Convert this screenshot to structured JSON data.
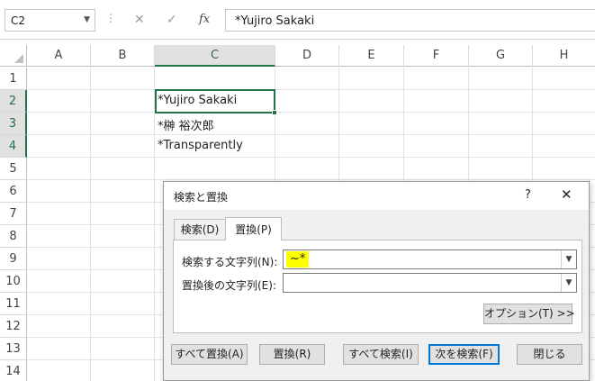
{
  "formula_bar": {
    "name_box": "C2",
    "cancel_symbol": "✕",
    "enter_symbol": "✓",
    "fx_label": "fx",
    "formula_value": "*Yujiro Sakaki"
  },
  "sheet": {
    "columns": [
      "A",
      "B",
      "C",
      "D",
      "E",
      "F",
      "G",
      "H"
    ],
    "rows": [
      "1",
      "2",
      "3",
      "4",
      "5",
      "6",
      "7",
      "8",
      "9",
      "10",
      "11",
      "12",
      "13",
      "14"
    ],
    "active_column": "C",
    "active_rows": [
      "2",
      "3",
      "4"
    ],
    "cells": {
      "C2": "*Yujiro Sakaki",
      "C3": "*榊 裕次郎",
      "C4": "*Transparently"
    }
  },
  "dialog": {
    "title": "検索と置換",
    "help": "?",
    "close_symbol": "✕",
    "tabs": [
      {
        "label": "検索(D)",
        "active": false
      },
      {
        "label": "置換(P)",
        "active": true
      }
    ],
    "find_label": "検索する文字列(N):",
    "find_value": "~*",
    "replace_label": "置換後の文字列(E):",
    "replace_value": "",
    "options_button": "オプション(T) >>",
    "buttons": {
      "replace_all": "すべて置換(A)",
      "replace": "置換(R)",
      "find_all": "すべて検索(I)",
      "find_next": "次を検索(F)",
      "close": "閉じる"
    }
  },
  "colors": {
    "excel_green": "#217346",
    "highlight": "#ffff00",
    "focus_blue": "#0078d7"
  }
}
